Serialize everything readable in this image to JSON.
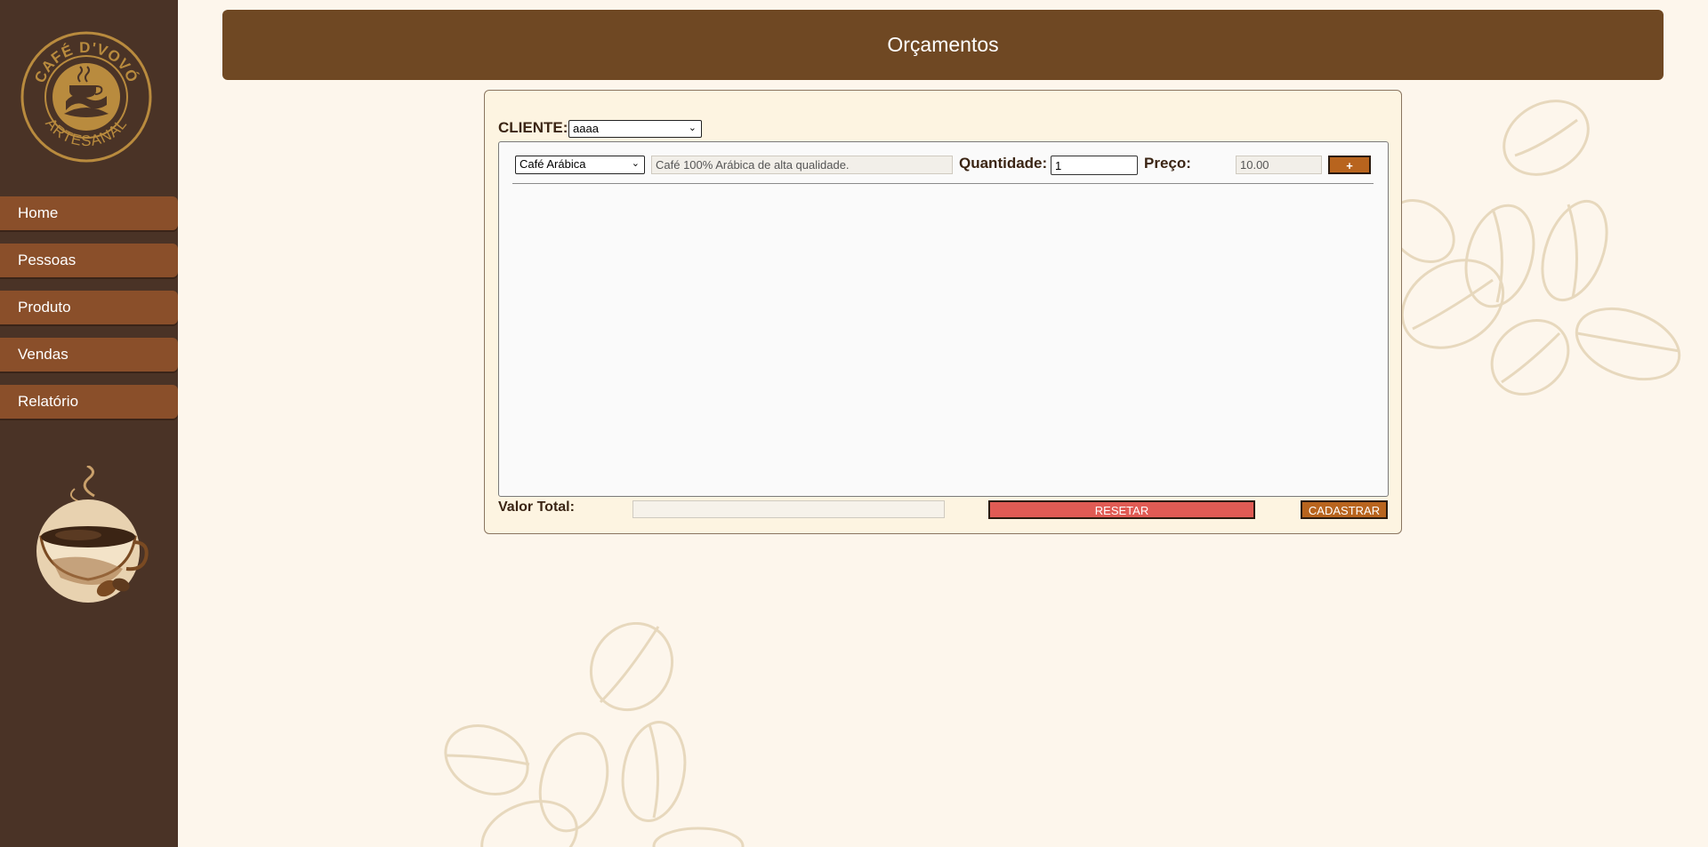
{
  "logo": {
    "top_text": "CAFÉ D'VOVÓ",
    "bottom_text": "ARTESANAL"
  },
  "nav": [
    {
      "label": "Home"
    },
    {
      "label": "Pessoas"
    },
    {
      "label": "Produto"
    },
    {
      "label": "Vendas"
    },
    {
      "label": "Relatório"
    }
  ],
  "header": {
    "title": "Orçamentos"
  },
  "form": {
    "cliente_label": "CLIENTE:",
    "cliente_value": "aaaa",
    "produto_value": "Café Arábica",
    "descricao_value": "Café 100% Arábica de alta qualidade.",
    "quantidade_label": "Quantidade:",
    "quantidade_value": "1",
    "preco_label": "Preço:",
    "preco_value": "10.00",
    "add_label": "+",
    "valor_total_label": "Valor Total:",
    "valor_total_value": "",
    "resetar_label": "RESETAR",
    "cadastrar_label": "CADASTRAR"
  },
  "colors": {
    "sidebar": "#4a3326",
    "nav_item": "#8a4f2a",
    "header": "#6f4823",
    "page_bg": "#fdf6ec",
    "card_bg": "#fdf4e1",
    "add_button": "#b8641e",
    "reset_button": "#e05b54",
    "cadastrar_button": "#b8641e"
  },
  "icons": [
    "cafe-dvovo-logo-icon",
    "coffee-cup-icon",
    "coffee-beans-decoration",
    "chevron-down-icon"
  ]
}
